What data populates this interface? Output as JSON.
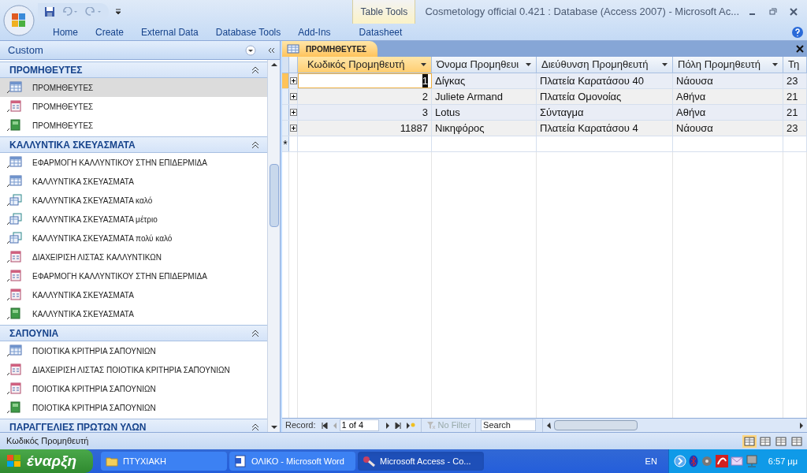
{
  "window": {
    "title": "Cosmetology official 0.421 : Database (Access 2007) - Microsoft Ac...",
    "contextual_group": "Table Tools"
  },
  "ribbon_tabs": [
    {
      "label": "Home",
      "selected": false
    },
    {
      "label": "Create",
      "selected": false
    },
    {
      "label": "External Data",
      "selected": false
    },
    {
      "label": "Database Tools",
      "selected": false
    },
    {
      "label": "Add-Ins",
      "selected": false
    },
    {
      "label": "Datasheet",
      "selected": false
    }
  ],
  "nav_pane": {
    "title": "Custom",
    "groups": [
      {
        "title": "ΠΡΟΜΗΘΕΥΤΕΣ",
        "expanded": true,
        "items": [
          {
            "kind": "table",
            "label": "ΠΡΟΜΗΘΕΥΤΕΣ",
            "selected": true
          },
          {
            "kind": "form",
            "label": "ΠΡΟΜΗΘΕΥΤΕΣ",
            "selected": false
          },
          {
            "kind": "report",
            "label": "ΠΡΟΜΗΘΕΥΤΕΣ",
            "selected": false
          }
        ]
      },
      {
        "title": "ΚΑΛΛΥΝΤΙΚΑ ΣΚΕΥΑΣΜΑΤΑ",
        "expanded": true,
        "items": [
          {
            "kind": "table",
            "label": "ΕΦΑΡΜΟΓΗ ΚΑΛΛΥΝΤΙΚΟΥ ΣΤΗΝ ΕΠΙΔΕΡΜΙΔΑ",
            "selected": false
          },
          {
            "kind": "table",
            "label": "ΚΑΛΛΥΝΤΙΚΑ ΣΚΕΥΑΣΜΑΤΑ",
            "selected": false
          },
          {
            "kind": "query",
            "label": "ΚΑΛΛΥΝΤΙΚΑ ΣΚΕΥΑΣΜΑΤΑ καλό",
            "selected": false
          },
          {
            "kind": "query",
            "label": "ΚΑΛΛΥΝΤΙΚΑ ΣΚΕΥΑΣΜΑΤΑ μέτριο",
            "selected": false
          },
          {
            "kind": "query",
            "label": "ΚΑΛΛΥΝΤΙΚΑ ΣΚΕΥΑΣΜΑΤΑ πολύ καλό",
            "selected": false
          },
          {
            "kind": "form",
            "label": "ΔΙΑΧΕΙΡΙΣΗ ΛΙΣΤΑΣ ΚΑΛΛΥΝΤΙΚΩΝ",
            "selected": false
          },
          {
            "kind": "form",
            "label": "ΕΦΑΡΜΟΓΗ ΚΑΛΛΥΝΤΙΚΟΥ ΣΤΗΝ ΕΠΙΔΕΡΜΙΔΑ",
            "selected": false
          },
          {
            "kind": "form",
            "label": "ΚΑΛΛΥΝΤΙΚΑ ΣΚΕΥΑΣΜΑΤΑ",
            "selected": false
          },
          {
            "kind": "report",
            "label": "ΚΑΛΛΥΝΤΙΚΑ ΣΚΕΥΑΣΜΑΤΑ",
            "selected": false
          }
        ]
      },
      {
        "title": "ΣΑΠΟΥΝΙΑ",
        "expanded": true,
        "items": [
          {
            "kind": "table",
            "label": "ΠΟΙΟΤΙΚΑ ΚΡΙΤΗΡΙΑ ΣΑΠΟΥΝΙΩΝ",
            "selected": false
          },
          {
            "kind": "form",
            "label": "ΔΙΑΧΕΙΡΙΣΗ ΛΙΣΤΑΣ ΠΟΙΟΤΙΚΑ ΚΡΙΤΗΡΙΑ ΣΑΠΟΥΝΙΩΝ",
            "selected": false
          },
          {
            "kind": "form",
            "label": "ΠΟΙΟΤΙΚΑ ΚΡΙΤΗΡΙΑ ΣΑΠΟΥΝΙΩΝ",
            "selected": false
          },
          {
            "kind": "report",
            "label": "ΠΟΙΟΤΙΚΑ ΚΡΙΤΗΡΙΑ ΣΑΠΟΥΝΙΩΝ",
            "selected": false
          }
        ]
      },
      {
        "title": "ΠΑΡΑΓΓΕΛΙΕΣ ΠΡΩΤΩΝ ΥΛΩΝ",
        "expanded": true
      }
    ]
  },
  "document_tab": {
    "title": "ΠΡΟΜΗΘΕΥΤΕΣ"
  },
  "table": {
    "columns": [
      "Κωδικός Προμηθευτή",
      "Όνομα Προμηθευι",
      "Διεύθυνση Προμηθευτή",
      "Πόλη Προμηθευτή",
      "Τη"
    ],
    "rows": [
      {
        "selected": true,
        "cells": [
          "1",
          "Δίγκας",
          "Πλατεία Καρατάσου 40",
          "Νάουσα",
          "23"
        ]
      },
      {
        "selected": false,
        "cells": [
          "2",
          "Juliete Armand",
          "Πλατεία Ομονοίας",
          "Αθήνα",
          "21"
        ]
      },
      {
        "selected": false,
        "cells": [
          "3",
          "Lotus",
          "Σύνταγμα",
          "Αθήνα",
          "21"
        ]
      },
      {
        "selected": false,
        "cells": [
          "11887",
          "Νικηφόρος",
          "Πλατεία Καρατάσου 4",
          "Νάουσα",
          "23"
        ]
      }
    ],
    "new_row_marker": "*"
  },
  "record_nav": {
    "label": "Record:",
    "position": "1 of 4",
    "filter": "No Filter",
    "search_placeholder": "Search"
  },
  "status_bar": {
    "text": "Κωδικός Προμηθευτή"
  },
  "taskbar": {
    "start": "έναρξη",
    "buttons": [
      {
        "label": "ΠΤΥΧΙΑΚΗ",
        "kind": "folder",
        "selected": false
      },
      {
        "label": "ΟΛΙΚΟ - Microsoft Word",
        "kind": "word",
        "selected": false
      },
      {
        "label": "Microsoft Access - Co...",
        "kind": "access",
        "selected": true
      }
    ],
    "language": "EN",
    "clock": "6:57 μμ"
  }
}
